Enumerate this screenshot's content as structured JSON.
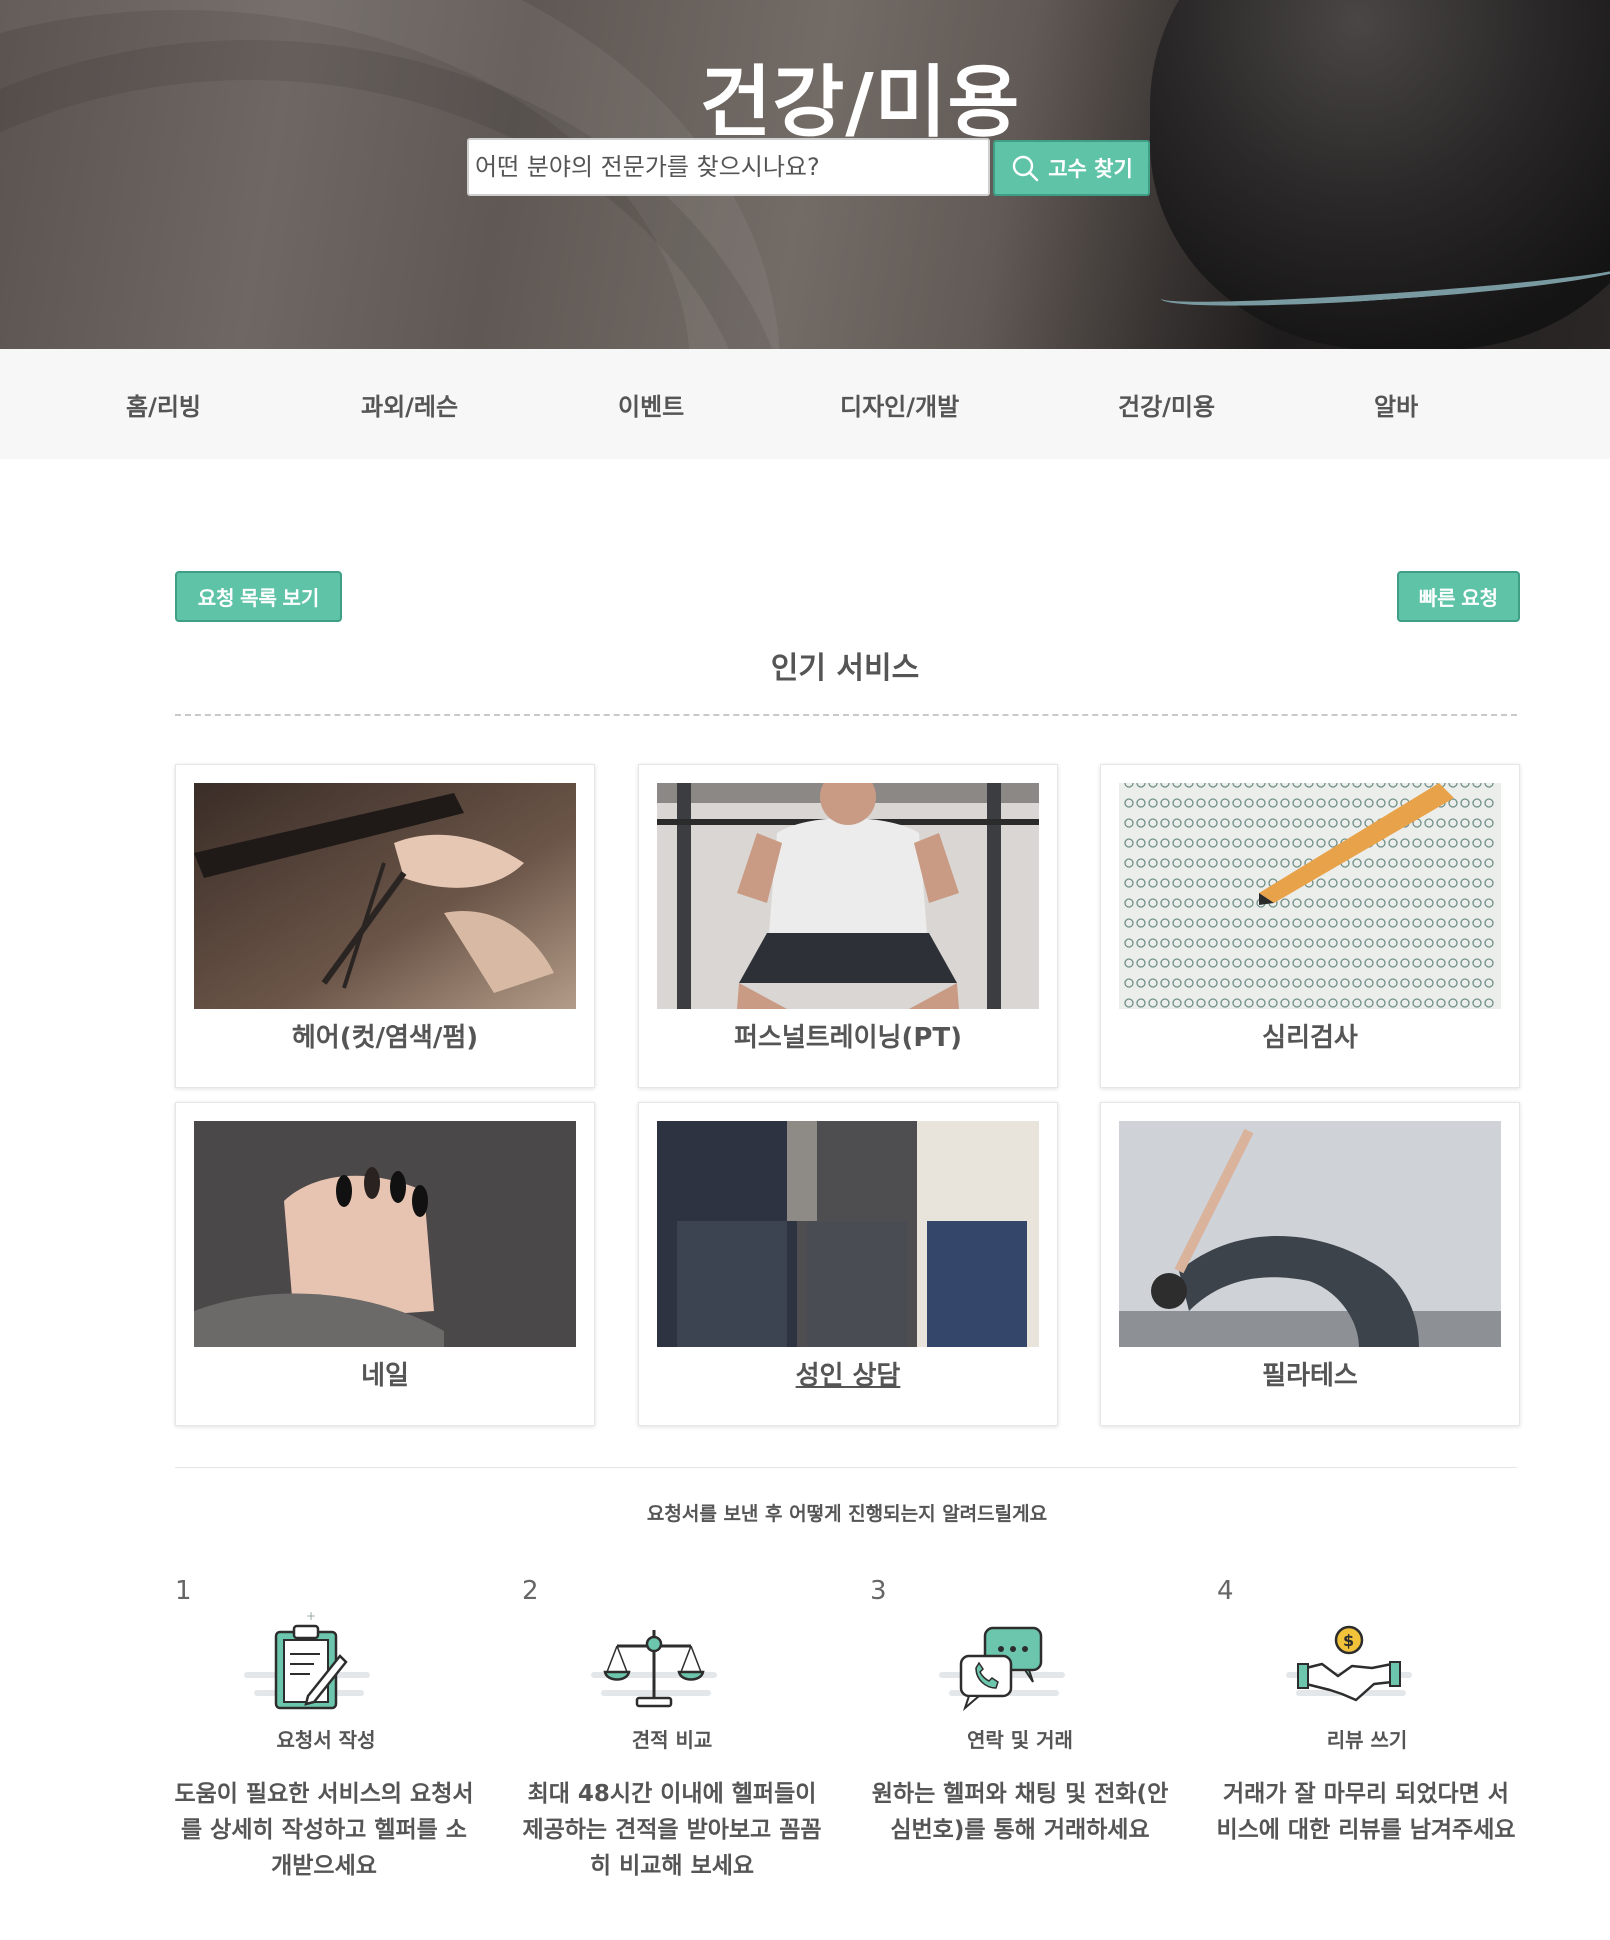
{
  "hero": {
    "title": "건강/미용",
    "search_placeholder": "어떤 분야의 전문가를 찾으시나요?",
    "search_button": "고수 찾기"
  },
  "nav": {
    "items": [
      "홈/리빙",
      "과외/레슨",
      "이벤트",
      "디자인/개발",
      "건강/미용",
      "알바"
    ]
  },
  "actions": {
    "request_list": "요청 목록 보기",
    "quick_request": "빠른 요청"
  },
  "popular": {
    "title": "인기 서비스",
    "cards": [
      {
        "label": "헤어(컷/염색/펌)"
      },
      {
        "label": "퍼스널트레이닝(PT)"
      },
      {
        "label": "심리검사"
      },
      {
        "label": "네일"
      },
      {
        "label": "성인 상담"
      },
      {
        "label": "필라테스"
      }
    ]
  },
  "process": {
    "title": "요청서를 보낸 후 어떻게 진행되는지 알려드릴게요",
    "steps": [
      {
        "num": "1",
        "title": "요청서 작성",
        "icon": "clipboard-icon",
        "desc": "도움이 필요한 서비스의 요청서를 상세히 작성하고 헬퍼를 소개받으세요"
      },
      {
        "num": "2",
        "title": "견적 비교",
        "icon": "scale-icon",
        "desc": "최대 48시간 이내에 헬퍼들이 제공하는 견적을 받아보고 꼼꼼히 비교해 보세요"
      },
      {
        "num": "3",
        "title": "연락 및 거래",
        "icon": "chat-phone-icon",
        "desc": "원하는 헬퍼와 채팅 및 전화(안심번호)를 통해 거래하세요"
      },
      {
        "num": "4",
        "title": "리뷰 쓰기",
        "icon": "handshake-icon",
        "desc": "거래가 잘 마무리 되었다면 서비스에 대한 리뷰를 남겨주세요"
      }
    ]
  },
  "colors": {
    "accent": "#5fc3a8",
    "accent_border": "#3f9f86",
    "nav_bg": "#f7f7f7",
    "text": "#555555"
  }
}
